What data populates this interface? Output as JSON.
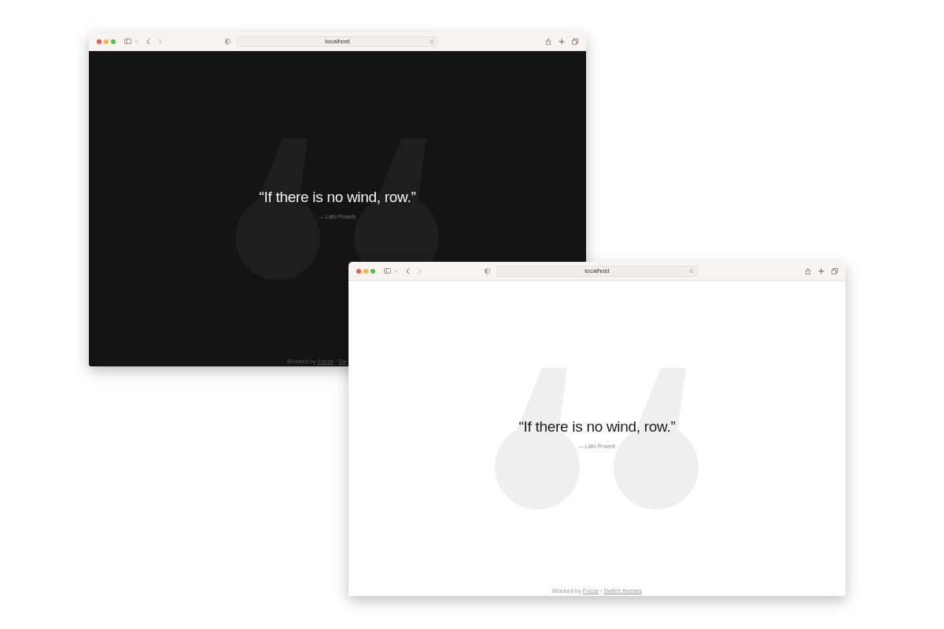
{
  "windows": [
    {
      "dark": true,
      "address": "localhost",
      "quote": "“If there is no wind, row.”",
      "attribution": "— Latin Proverb",
      "footer": {
        "text": "Blocked by",
        "link": "Focus",
        "separator": "/",
        "link2": "Sw"
      }
    },
    {
      "dark": false,
      "address": "localhost",
      "quote": "“If there is no wind, row.”",
      "attribution": "— Latin Proverb",
      "footer": {
        "text": "Blocked by",
        "link": "Focus",
        "separator": "/",
        "link2": "Switch themes"
      }
    }
  ]
}
